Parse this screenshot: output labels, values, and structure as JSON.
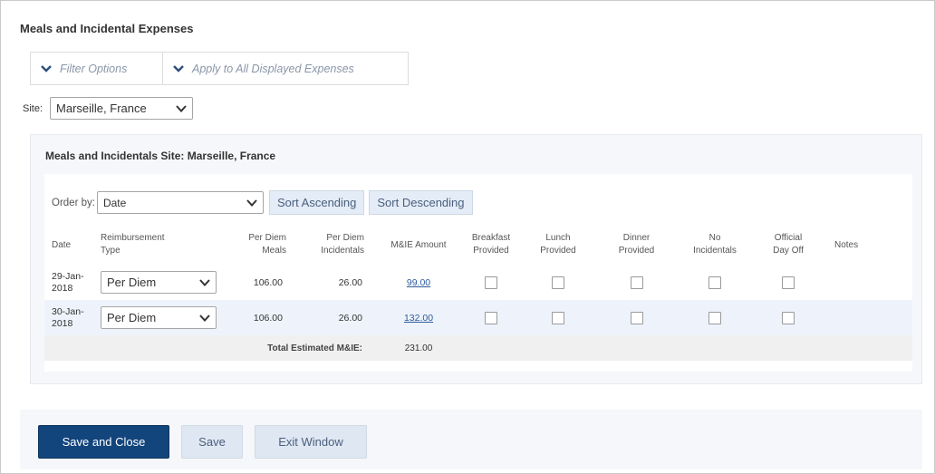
{
  "section_title": "Meals and Incidental Expenses",
  "filter_options": "Filter Options",
  "apply_all": "Apply to All Displayed Expenses",
  "site_label": "Site:",
  "site_value": "Marseille, France",
  "panel_title": "Meals and Incidentals Site: Marseille, France",
  "order_by_label": "Order by:",
  "order_by_value": "Date",
  "sort_ascending": "Sort Ascending",
  "sort_descending": "Sort Descending",
  "columns": {
    "date": "Date",
    "reimb_1": "Reimbursement",
    "reimb_2": "Type",
    "pdm_1": "Per Diem",
    "pdm_2": "Meals",
    "pdi_1": "Per Diem",
    "pdi_2": "Incidentals",
    "mie": "M&IE Amount",
    "bf_1": "Breakfast",
    "bf_2": "Provided",
    "lu_1": "Lunch",
    "lu_2": "Provided",
    "di_1": "Dinner",
    "di_2": "Provided",
    "noinc_1": "No",
    "noinc_2": "Incidentals",
    "off_1": "Official",
    "off_2": "Day Off",
    "notes": "Notes"
  },
  "rows": [
    {
      "date_1": "29-Jan-",
      "date_2": "2018",
      "type": "Per Diem",
      "meals": "106.00",
      "incidentals": "26.00",
      "amount": "99.00"
    },
    {
      "date_1": "30-Jan-",
      "date_2": "2018",
      "type": "Per Diem",
      "meals": "106.00",
      "incidentals": "26.00",
      "amount": "132.00"
    }
  ],
  "total_label": "Total Estimated M&IE:",
  "total_value": "231.00",
  "buttons": {
    "save_close": "Save and Close",
    "save": "Save",
    "exit": "Exit Window"
  }
}
